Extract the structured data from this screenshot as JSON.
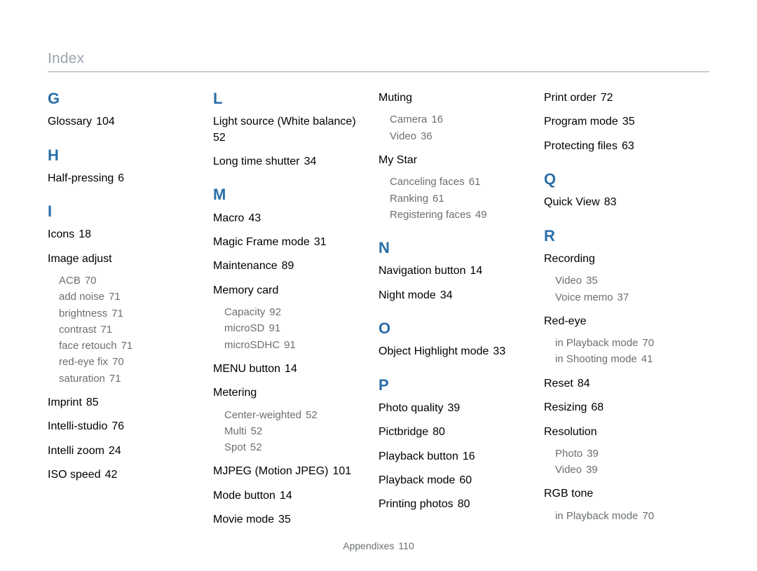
{
  "page_title": "Index",
  "footer": {
    "label": "Appendixes",
    "page": "110"
  },
  "col1": {
    "G": {
      "letter": "G",
      "items": [
        {
          "label": "Glossary",
          "page": "104"
        }
      ]
    },
    "H": {
      "letter": "H",
      "items": [
        {
          "label": "Half-pressing",
          "page": "6"
        }
      ]
    },
    "I": {
      "letter": "I",
      "items": [
        {
          "label": "Icons",
          "page": "18"
        },
        {
          "label": "Image adjust",
          "subs": [
            {
              "label": "ACB",
              "page": "70"
            },
            {
              "label": "add noise",
              "page": "71"
            },
            {
              "label": "brightness",
              "page": "71"
            },
            {
              "label": "contrast",
              "page": "71"
            },
            {
              "label": "face retouch",
              "page": "71"
            },
            {
              "label": "red-eye fix",
              "page": "70"
            },
            {
              "label": "saturation",
              "page": "71"
            }
          ]
        },
        {
          "label": "Imprint",
          "page": "85"
        },
        {
          "label": "Intelli-studio",
          "page": "76"
        },
        {
          "label": "Intelli zoom",
          "page": "24"
        },
        {
          "label": "ISO speed",
          "page": "42"
        }
      ]
    }
  },
  "col2": {
    "L": {
      "letter": "L",
      "items": [
        {
          "label": "Light source (White balance)",
          "page_newline": "52"
        },
        {
          "label": "Long time shutter",
          "page": "34"
        }
      ]
    },
    "M": {
      "letter": "M",
      "items": [
        {
          "label": "Macro",
          "page": "43"
        },
        {
          "label": "Magic Frame mode",
          "page": "31"
        },
        {
          "label": "Maintenance",
          "page": "89"
        },
        {
          "label": "Memory card",
          "subs": [
            {
              "label": "Capacity",
              "page": "92"
            },
            {
              "label": "microSD",
              "page": "91"
            },
            {
              "label": "microSDHC",
              "page": "91"
            }
          ]
        },
        {
          "label": "MENU button",
          "page": "14"
        },
        {
          "label": "Metering",
          "subs": [
            {
              "label": "Center-weighted",
              "page": "52"
            },
            {
              "label": "Multi",
              "page": "52"
            },
            {
              "label": "Spot",
              "page": "52"
            }
          ]
        },
        {
          "label": "MJPEG (Motion JPEG)",
          "page": "101"
        },
        {
          "label": "Mode button",
          "page": "14"
        },
        {
          "label": "Movie mode",
          "page": "35"
        }
      ]
    }
  },
  "col3": {
    "cont": {
      "items": [
        {
          "label": "Muting",
          "subs": [
            {
              "label": "Camera",
              "page": "16"
            },
            {
              "label": "Video",
              "page": "36"
            }
          ]
        },
        {
          "label": "My Star",
          "subs": [
            {
              "label": "Canceling faces",
              "page": "61"
            },
            {
              "label": "Ranking",
              "page": "61"
            },
            {
              "label": "Registering faces",
              "page": "49"
            }
          ]
        }
      ]
    },
    "N": {
      "letter": "N",
      "items": [
        {
          "label": "Navigation button",
          "page": "14"
        },
        {
          "label": "Night mode",
          "page": "34"
        }
      ]
    },
    "O": {
      "letter": "O",
      "items": [
        {
          "label": "Object Highlight mode",
          "page": "33"
        }
      ]
    },
    "P": {
      "letter": "P",
      "items": [
        {
          "label": "Photo quality",
          "page": "39"
        },
        {
          "label": "Pictbridge",
          "page": "80"
        },
        {
          "label": "Playback button",
          "page": "16"
        },
        {
          "label": "Playback mode",
          "page": "60"
        },
        {
          "label": "Printing photos",
          "page": "80"
        }
      ]
    }
  },
  "col4": {
    "cont": {
      "items": [
        {
          "label": "Print order",
          "page": "72"
        },
        {
          "label": "Program mode",
          "page": "35"
        },
        {
          "label": "Protecting files",
          "page": "63"
        }
      ]
    },
    "Q": {
      "letter": "Q",
      "items": [
        {
          "label": "Quick View",
          "page": "83"
        }
      ]
    },
    "R": {
      "letter": "R",
      "items": [
        {
          "label": "Recording",
          "subs": [
            {
              "label": "Video",
              "page": "35"
            },
            {
              "label": "Voice memo",
              "page": "37"
            }
          ]
        },
        {
          "label": "Red-eye",
          "subs": [
            {
              "label": "in Playback mode",
              "page": "70"
            },
            {
              "label": "in Shooting mode",
              "page": "41"
            }
          ]
        },
        {
          "label": "Reset",
          "page": "84"
        },
        {
          "label": "Resizing",
          "page": "68"
        },
        {
          "label": "Resolution",
          "subs": [
            {
              "label": "Photo",
              "page": "39"
            },
            {
              "label": "Video",
              "page": "39"
            }
          ]
        },
        {
          "label": "RGB tone",
          "subs": [
            {
              "label": "in Playback mode",
              "page": "70"
            }
          ]
        }
      ]
    }
  }
}
